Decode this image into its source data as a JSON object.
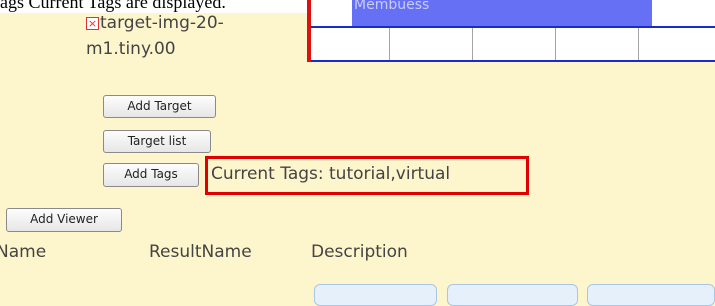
{
  "caption": "ags Current Tags are displayed.",
  "target": {
    "line1": "target-img-20-",
    "line2": "m1.tiny.00",
    "icon": "broken-image-icon"
  },
  "timeline": {
    "bar_label": "Membuess"
  },
  "buttons": {
    "add_target": "Add Target",
    "target_list": "Target list",
    "add_tags": "Add Tags",
    "add_viewer": "Add Viewer"
  },
  "tags": {
    "text": "Current Tags: tutorial,virtual"
  },
  "table": {
    "columns": [
      "Name",
      "ResultName",
      "Description"
    ]
  },
  "colors": {
    "background": "#fdf5cc",
    "timeline_bar": "#6670f5",
    "highlight": "#e00000",
    "timeline_line": "#1d2bc5"
  }
}
